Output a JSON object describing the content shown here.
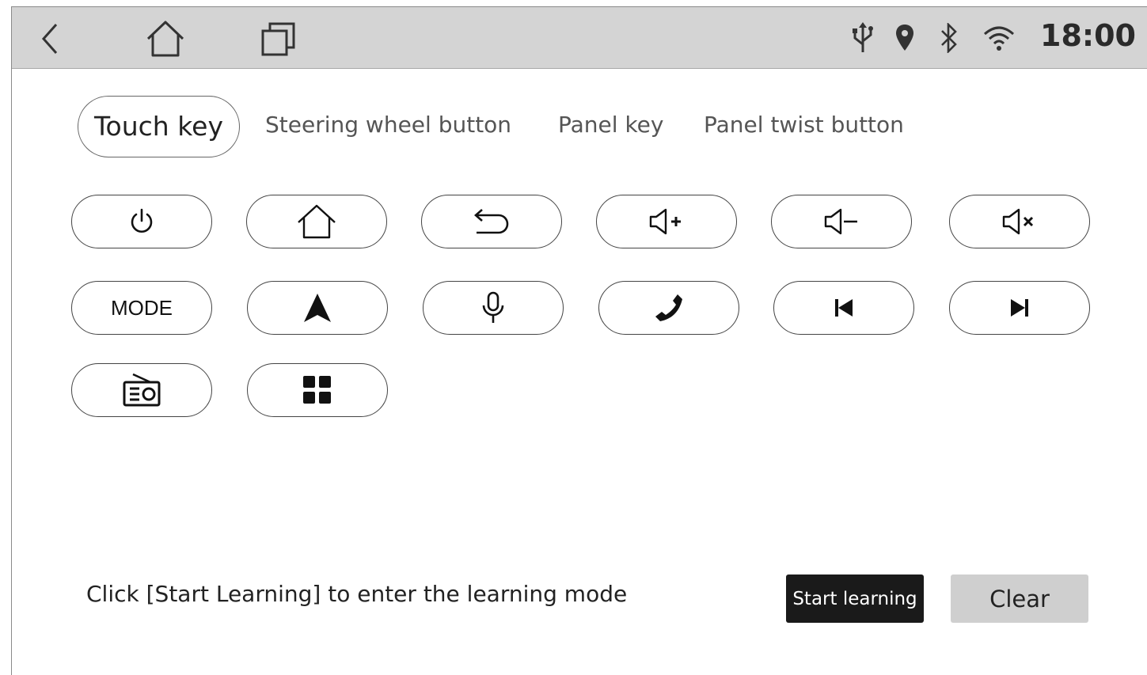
{
  "status_bar": {
    "time": "18:00",
    "nav_icons": [
      "back-icon",
      "home-icon",
      "recent-apps-icon"
    ],
    "status_icons": [
      "usb-icon",
      "location-icon",
      "bluetooth-icon",
      "wifi-icon"
    ]
  },
  "tabs": [
    {
      "label": "Touch key",
      "active": true
    },
    {
      "label": "Steering wheel button",
      "active": false
    },
    {
      "label": "Panel key",
      "active": false
    },
    {
      "label": "Panel twist button",
      "active": false
    }
  ],
  "keys": [
    {
      "icon": "power-icon"
    },
    {
      "icon": "home-icon"
    },
    {
      "icon": "back-arrow-icon"
    },
    {
      "icon": "volume-up-icon"
    },
    {
      "icon": "volume-down-icon"
    },
    {
      "icon": "mute-icon"
    },
    {
      "label": "MODE"
    },
    {
      "icon": "navigation-icon"
    },
    {
      "icon": "microphone-icon"
    },
    {
      "icon": "phone-icon"
    },
    {
      "icon": "previous-track-icon"
    },
    {
      "icon": "next-track-icon"
    },
    {
      "icon": "radio-icon"
    },
    {
      "icon": "apps-grid-icon"
    }
  ],
  "footer": {
    "hint": "Click [Start Learning] to enter the learning mode",
    "start_label": "Start learning",
    "clear_label": "Clear"
  }
}
